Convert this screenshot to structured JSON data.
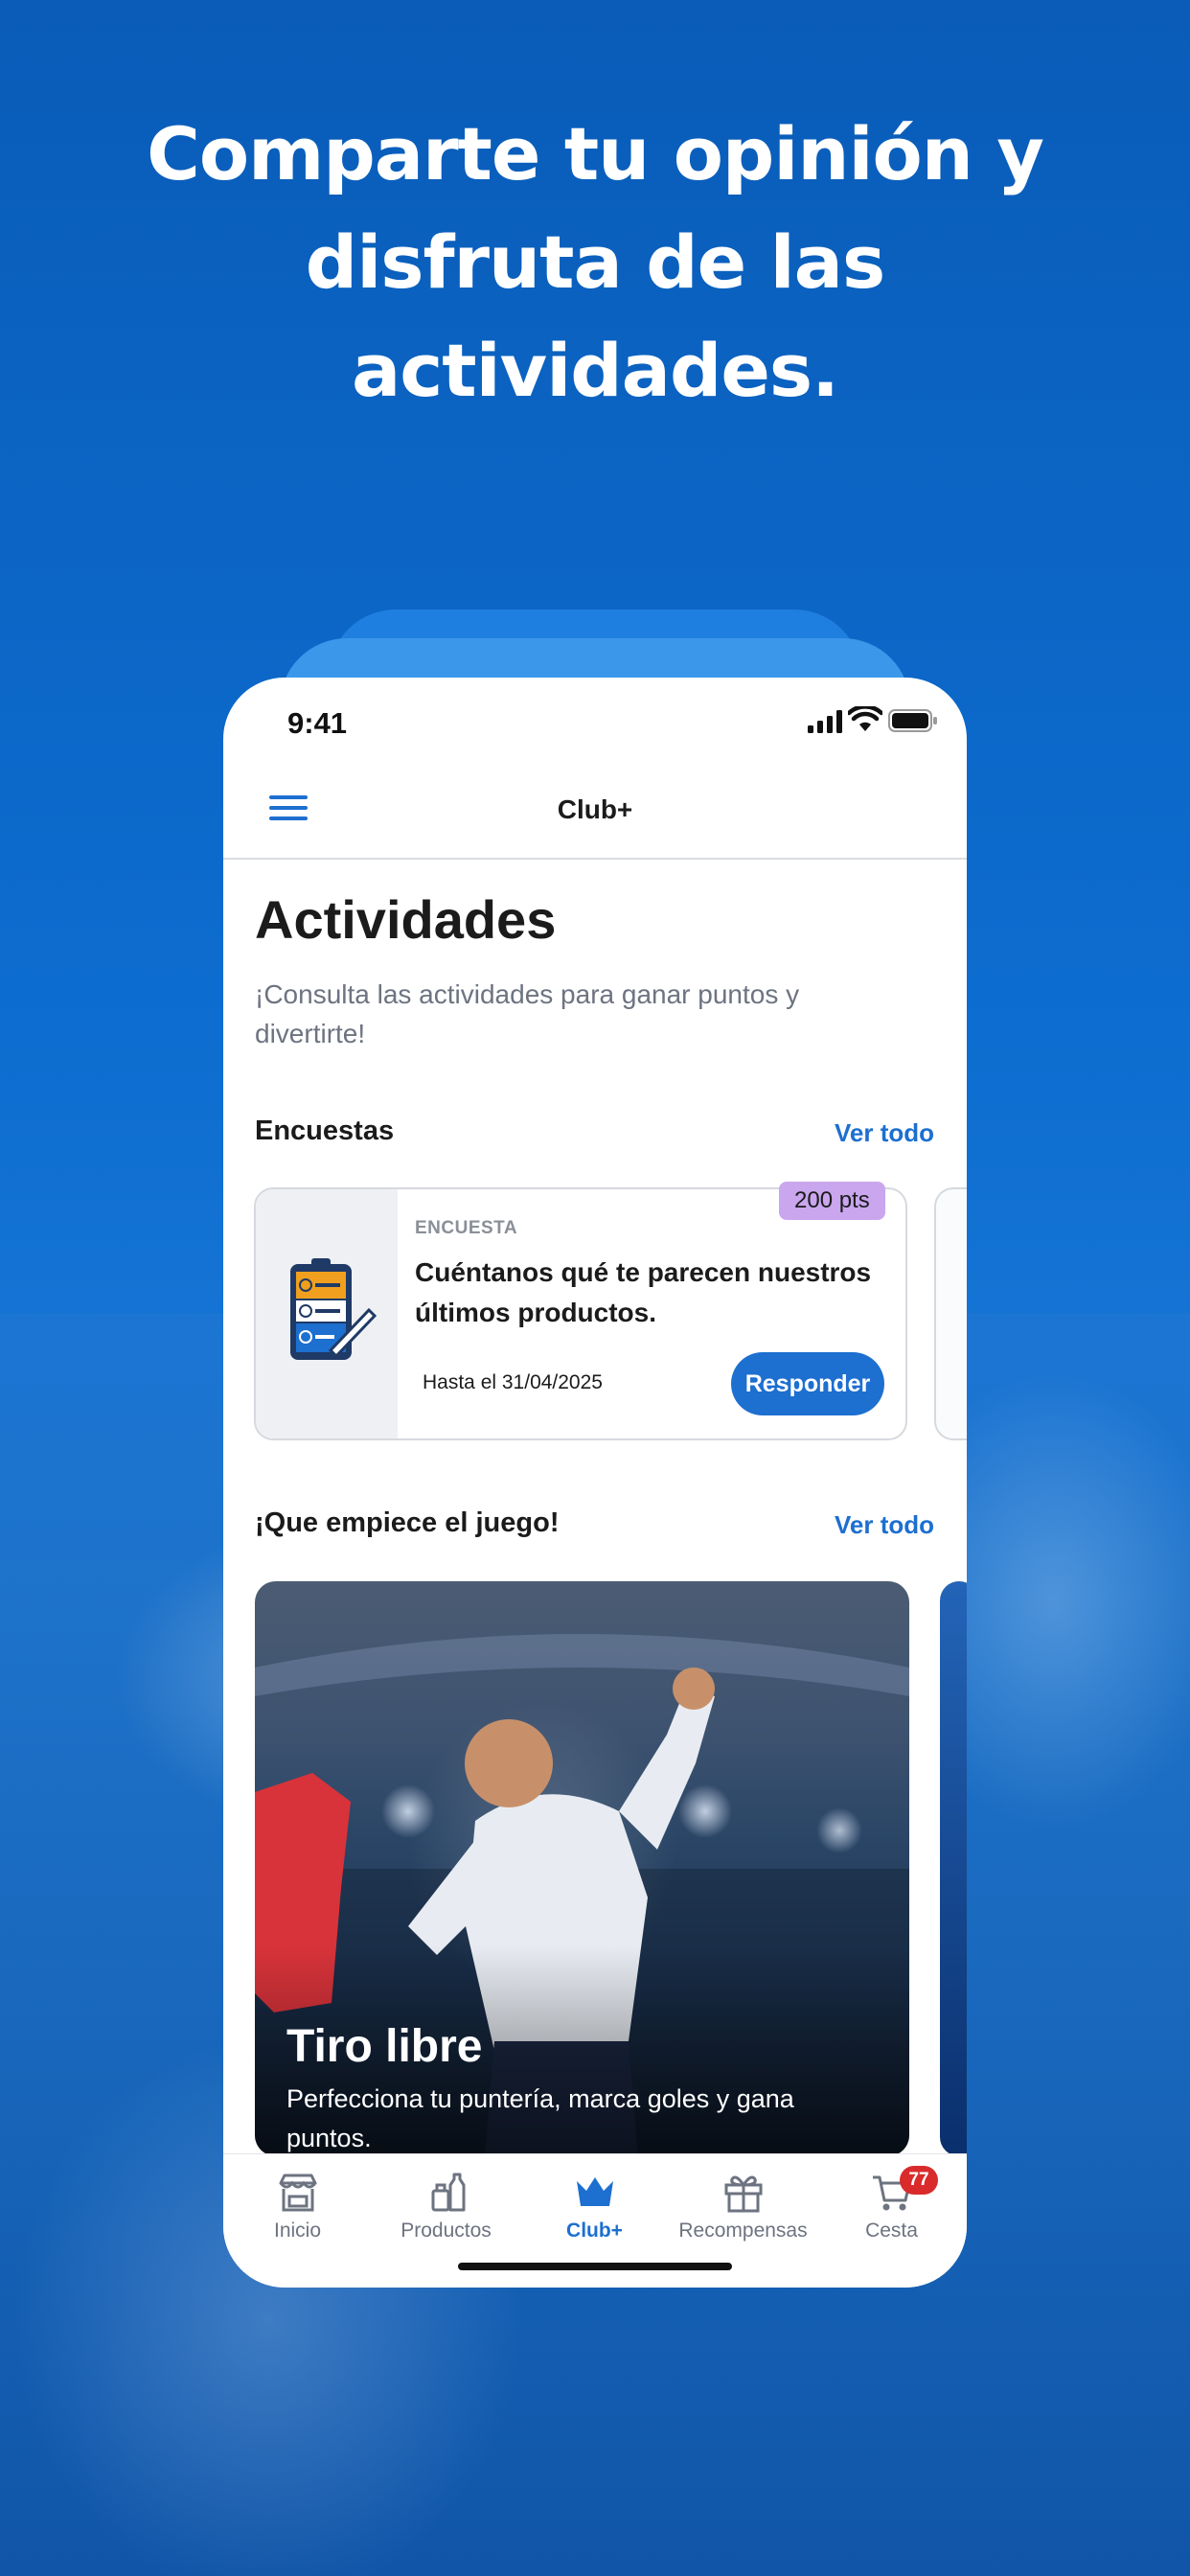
{
  "headline": {
    "line1": "Comparte tu opinión y",
    "line2": "disfruta de las",
    "line3": "actividades."
  },
  "status_bar": {
    "time": "9:41"
  },
  "navbar": {
    "title": "Club+"
  },
  "page": {
    "title": "Actividades",
    "subtitle": "¡Consulta las actividades para ganar puntos y divertirte!"
  },
  "surveys": {
    "heading": "Encuestas",
    "see_all": "Ver todo",
    "card": {
      "points": "200 pts",
      "category": "ENCUESTA",
      "title": "Cuéntanos qué te parecen nuestros últimos productos.",
      "deadline": "Hasta el 31/04/2025",
      "cta": "Responder"
    }
  },
  "games": {
    "heading": "¡Que empiece el juego!",
    "see_all": "Ver todo",
    "card": {
      "title": "Tiro libre",
      "subtitle": "Perfecciona tu puntería, marca goles y gana puntos."
    }
  },
  "tabbar": {
    "items": [
      {
        "label": "Inicio",
        "icon": "store-icon"
      },
      {
        "label": "Productos",
        "icon": "products-icon"
      },
      {
        "label": "Club+",
        "icon": "crown-icon",
        "active": true
      },
      {
        "label": "Recompensas",
        "icon": "gift-icon"
      },
      {
        "label": "Cesta",
        "icon": "cart-icon",
        "badge": "77"
      }
    ]
  },
  "colors": {
    "accent": "#1d6fd0",
    "points_badge": "#c9a6ee",
    "cart_badge": "#d92b2b",
    "background": "#0d6dd0"
  }
}
